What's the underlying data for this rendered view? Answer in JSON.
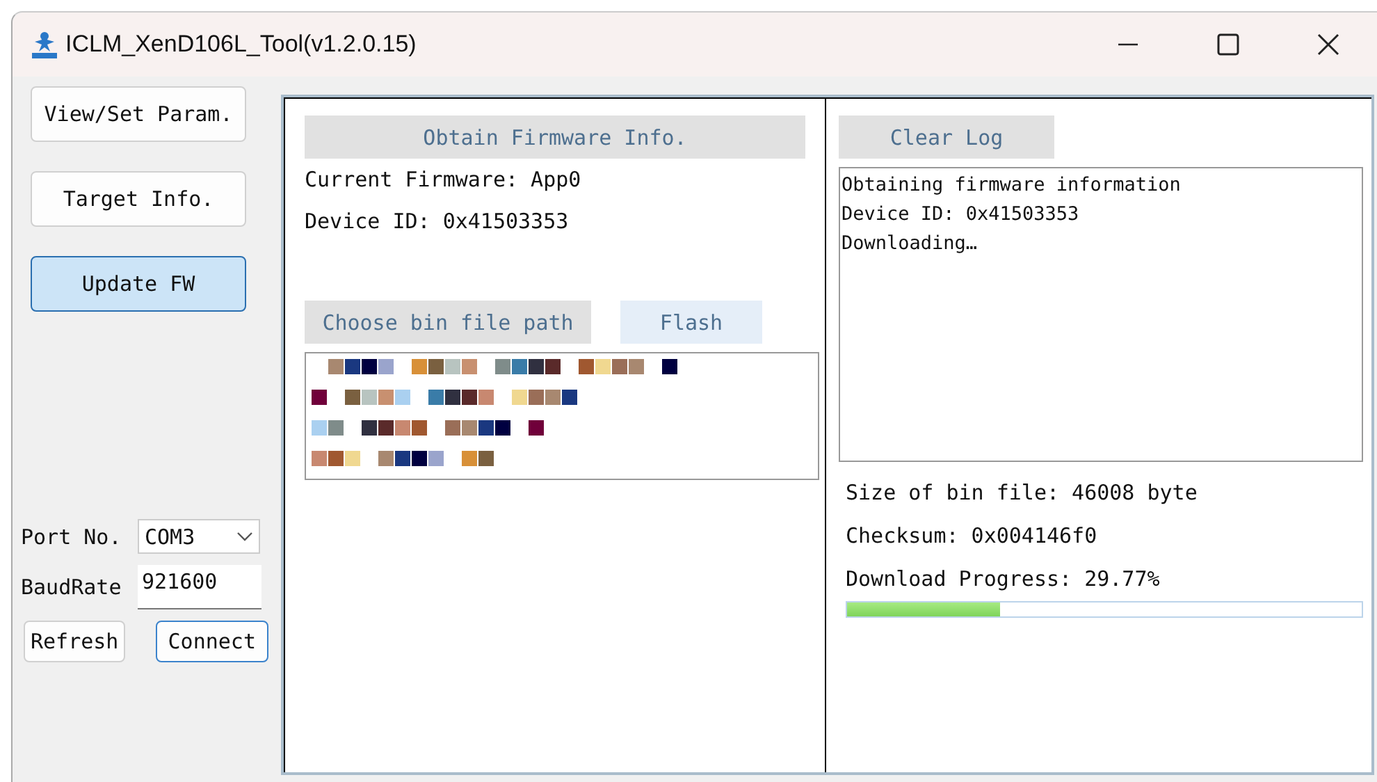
{
  "window": {
    "title": "ICLM_XenD106L_Tool(v1.2.0.15)"
  },
  "nav_buttons": [
    {
      "label": "View/Set Param.",
      "selected": false
    },
    {
      "label": "Target Info.",
      "selected": false
    },
    {
      "label": "Update FW",
      "selected": true
    }
  ],
  "port": {
    "label": "Port No.",
    "value": "COM3"
  },
  "baud_rate": {
    "label": "BaudRate",
    "value": "921600"
  },
  "connection_buttons": [
    {
      "label": "Refresh",
      "focused": false
    },
    {
      "label": "Connect",
      "focused": true
    }
  ],
  "firmware": {
    "obtain_button": "Obtain Firmware Info.",
    "current_firmware": "Current Firmware: App0",
    "device_id": "Device ID: 0x41503353",
    "choose_button": "Choose bin file path",
    "flash_button": "Flash"
  },
  "log": {
    "clear_button": "Clear Log",
    "lines": [
      "Obtaining firmware information",
      "Device ID: 0x41503353",
      "Downloading…"
    ]
  },
  "download": {
    "size": "Size of bin file: 46008 byte",
    "checksum": "Checksum: 0x004146f0",
    "progress_label": "Download Progress: 29.77%",
    "level": 0.2977
  }
}
